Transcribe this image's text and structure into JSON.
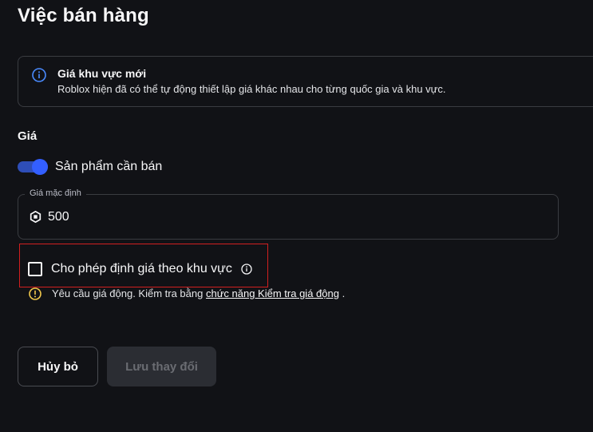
{
  "page": {
    "title": "Việc bán hàng"
  },
  "banner": {
    "title": "Giá khu vực mới",
    "body": "Roblox hiện đã có thể tự động thiết lập giá khác nhau cho từng quốc gia và khu vực.",
    "icon": "info-icon"
  },
  "pricing": {
    "section_label": "Giá",
    "toggle": {
      "label": "Sản phẩm cần bán",
      "state": "on"
    },
    "default_price": {
      "label": "Giá mặc định",
      "value": "500",
      "icon": "robux-icon"
    },
    "regional": {
      "checkbox_label": "Cho phép định giá theo khu vực",
      "checked": false
    },
    "warning": {
      "text": "Yêu cầu giá động. Kiểm tra bằng",
      "link": "chức năng Kiểm tra giá động",
      "suffix": "."
    }
  },
  "actions": {
    "cancel_label": "Hủy bỏ",
    "save_label": "Lưu thay đổi"
  },
  "colors": {
    "background": "#111216",
    "accent": "#335fff",
    "warning": "#f2c94c",
    "highlight": "#d21f1f"
  }
}
